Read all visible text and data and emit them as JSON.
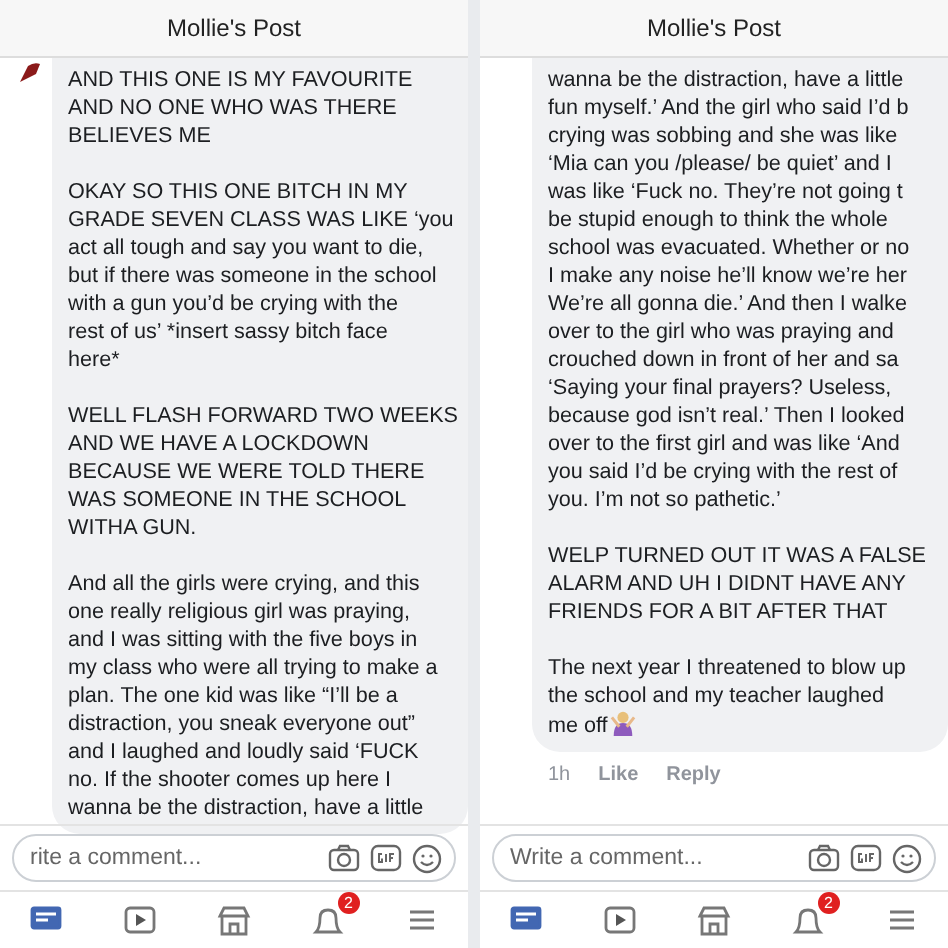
{
  "panels": [
    {
      "header": {
        "title": "Mollie's Post"
      },
      "avatar": true,
      "paragraphs": [
        {
          "lines": [
            "AND THIS ONE IS MY FAVOURITE",
            "AND NO ONE WHO WAS THERE",
            "BELIEVES ME"
          ]
        },
        {
          "lines": [
            "OKAY SO THIS ONE BITCH IN MY",
            "GRADE SEVEN CLASS WAS LIKE ‘you",
            "act all tough and say you want to die,",
            "but if there was someone in the school",
            "with a gun you’d be crying with the",
            "rest of us’ *insert sassy bitch face",
            "here*"
          ]
        },
        {
          "lines": [
            "WELL FLASH FORWARD TWO WEEKS",
            "AND WE HAVE A LOCKDOWN",
            "BECAUSE WE WERE TOLD THERE",
            "WAS SOMEONE IN THE SCHOOL",
            "WITHA GUN."
          ]
        },
        {
          "lines": [
            "And all the girls were crying, and this",
            "one really religious girl was praying,",
            "and I was sitting with the five boys in",
            "my class who were all trying to make a",
            "plan. The one kid was like “I’ll be a",
            "distraction, you sneak everyone out”",
            "and I laughed and loudly said ‘FUCK",
            "no. If the shooter comes up here I",
            "wanna be the distraction, have a little"
          ]
        }
      ],
      "composer": {
        "placeholder": "rite a comment..."
      },
      "nav": [
        {
          "kind": "feed",
          "selected": true
        },
        {
          "kind": "video",
          "selected": false
        },
        {
          "kind": "store",
          "selected": false
        },
        {
          "kind": "bell",
          "selected": false,
          "badge": "2"
        },
        {
          "kind": "menu",
          "selected": false
        }
      ]
    },
    {
      "header": {
        "title": "Mollie's Post"
      },
      "paragraphs": [
        {
          "lines": [
            "wanna be the distraction, have a little",
            "fun myself.’ And the girl who said I’d b",
            "crying was sobbing and she was like",
            "‘Mia can you /please/ be quiet’ and I",
            "was like ‘Fuck no. They’re not going t",
            "be stupid enough to think the whole",
            "school was evacuated. Whether or no",
            "I make any noise he’ll know we’re her",
            "We’re all gonna die.’ And then I walke",
            "over to the girl who was praying and",
            "crouched down in front of her and sa",
            "‘Saying your final prayers? Useless,",
            "because god isn’t real.’ Then I looked",
            "over to the first girl and was like ‘And",
            "you said I’d be crying with the rest of",
            "you. I’m not so pathetic.’"
          ]
        },
        {
          "lines": [
            "WELP TURNED OUT IT WAS A FALSE",
            "ALARM AND UH I DIDNT HAVE ANY",
            "FRIENDS FOR A BIT AFTER THAT"
          ]
        },
        {
          "lines": [
            "The next year I threatened to blow up",
            "the school and my teacher laughed",
            "me off"
          ],
          "emoji": true
        }
      ],
      "meta": [
        "1h",
        "Like",
        "Reply"
      ],
      "composer": {
        "placeholder": "Write a comment..."
      },
      "nav": [
        {
          "kind": "feed",
          "selected": true
        },
        {
          "kind": "video",
          "selected": false
        },
        {
          "kind": "store",
          "selected": false
        },
        {
          "kind": "bell",
          "selected": false,
          "badge": "2"
        },
        {
          "kind": "menu",
          "selected": false
        }
      ]
    }
  ]
}
